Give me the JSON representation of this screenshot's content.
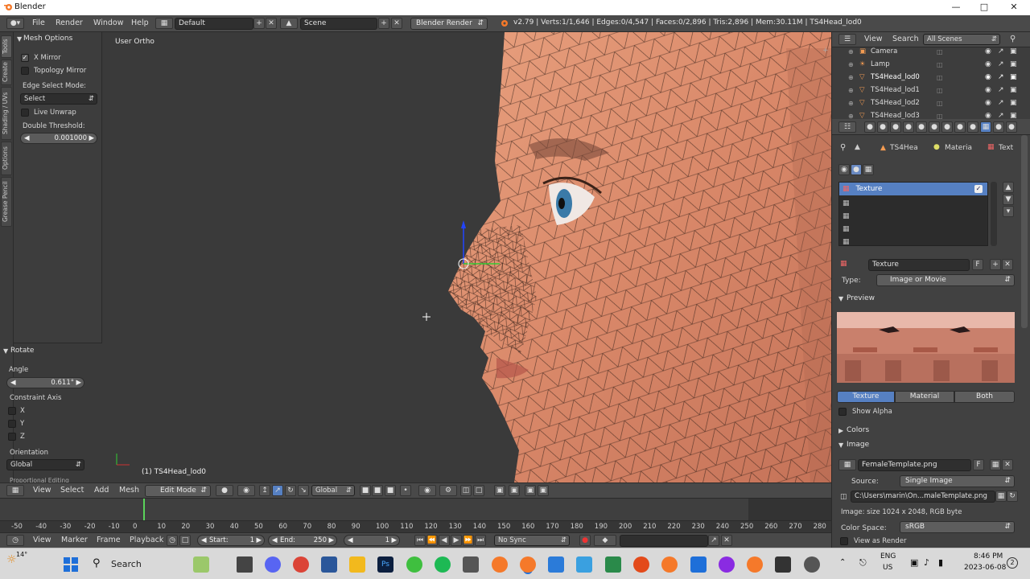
{
  "window": {
    "title": "Blender"
  },
  "topbar": {
    "menus": [
      "File",
      "Render",
      "Window",
      "Help"
    ],
    "layout": "Default",
    "scene": "Scene",
    "engine": "Blender Render",
    "stats": "v2.79 | Verts:1/1,646 | Edges:0/4,547 | Faces:0/2,896 | Tris:2,896 | Mem:30.11M | TS4Head_lod0"
  },
  "toolshelf": {
    "tabs": [
      "Tools",
      "Create",
      "Shading / UVs",
      "Options",
      "Grease Pencil"
    ],
    "mesh_options": {
      "header": "Mesh Options",
      "x_mirror": "X Mirror",
      "topology_mirror": "Topology Mirror",
      "edge_select_label": "Edge Select Mode:",
      "edge_select_value": "Select",
      "live_unwrap": "Live Unwrap",
      "double_threshold_label": "Double Threshold:",
      "double_threshold_value": "0.001000"
    },
    "operator": {
      "header": "Rotate",
      "angle_label": "Angle",
      "angle_value": "0.611°",
      "constraint_label": "Constraint Axis",
      "x": "X",
      "y": "Y",
      "z": "Z",
      "orientation_label": "Orientation",
      "orientation_value": "Global",
      "proportional": "Proportional Editing"
    }
  },
  "viewport": {
    "view_label": "User Ortho",
    "object_label": "(1) TS4Head_lod0"
  },
  "view3d_header": {
    "menus": [
      "View",
      "Select",
      "Add",
      "Mesh"
    ],
    "mode": "Edit Mode",
    "orientation": "Global"
  },
  "timeline": {
    "ticks": [
      "-50",
      "-40",
      "-30",
      "-20",
      "-10",
      "0",
      "10",
      "20",
      "30",
      "40",
      "50",
      "60",
      "70",
      "80",
      "90",
      "100",
      "110",
      "120",
      "130",
      "140",
      "150",
      "160",
      "170",
      "180",
      "190",
      "200",
      "210",
      "220",
      "230",
      "240",
      "250",
      "260",
      "270",
      "280"
    ],
    "menus": [
      "View",
      "Marker",
      "Frame",
      "Playback"
    ],
    "start_label": "Start:",
    "start_value": "1",
    "end_label": "End:",
    "end_value": "250",
    "current_frame": "1",
    "sync": "No Sync"
  },
  "outliner": {
    "menus": [
      "View",
      "Search"
    ],
    "filter": "All Scenes",
    "items": [
      {
        "name": "Camera"
      },
      {
        "name": "Lamp"
      },
      {
        "name": "TS4Head_lod0"
      },
      {
        "name": "TS4Head_lod1"
      },
      {
        "name": "TS4Head_lod2"
      },
      {
        "name": "TS4Head_lod3"
      }
    ]
  },
  "properties": {
    "breadcrumb": {
      "object": "TS4Hea",
      "material": "Materia",
      "texture": "Text"
    },
    "slot_name": "Texture",
    "texture_name": "Texture",
    "texture_flag": "F",
    "type_label": "Type:",
    "type_value": "Image or Movie",
    "preview_header": "Preview",
    "preview_tabs": [
      "Texture",
      "Material",
      "Both"
    ],
    "show_alpha": "Show Alpha",
    "colors_header": "Colors",
    "image_header": "Image",
    "image_name": "FemaleTemplate.png",
    "image_flag": "F",
    "source_label": "Source:",
    "source_value": "Single Image",
    "filepath": "C:\\Users\\marin\\On...maleTemplate.png",
    "image_info": "Image: size 1024 x 2048, RGB byte",
    "colorspace_label": "Color Space:",
    "colorspace_value": "sRGB",
    "view_as_render": "View as Render"
  },
  "taskbar": {
    "weather": "14°",
    "search": "Search",
    "lang": "ENG",
    "region": "US",
    "time": "8:46 PM",
    "date": "2023-06-08",
    "notif": "2"
  }
}
